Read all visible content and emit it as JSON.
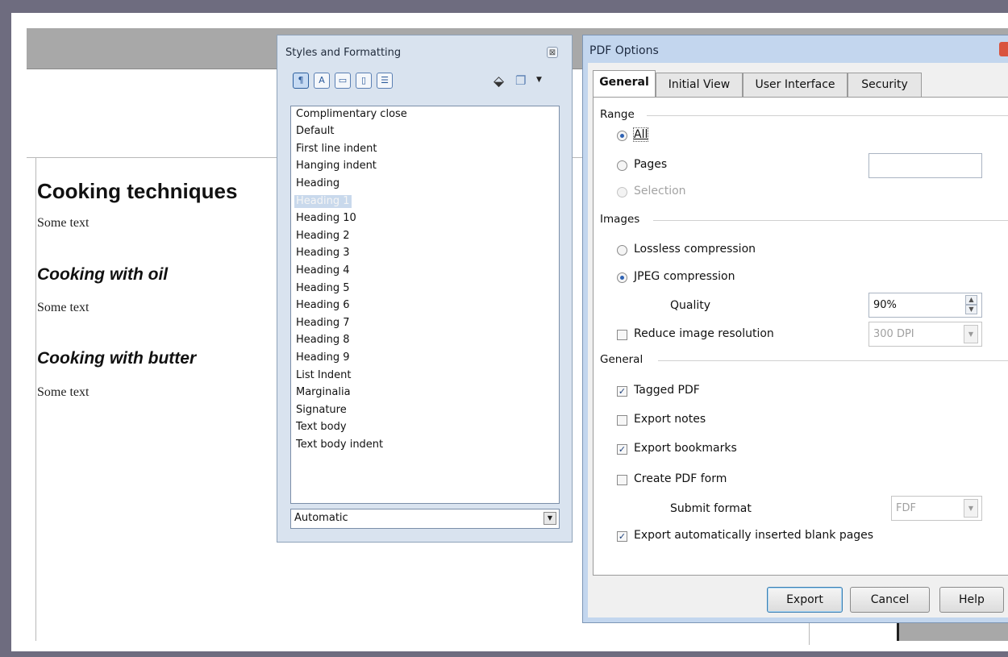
{
  "document": {
    "heading1": "Cooking techniques",
    "p1": "Some text",
    "heading2a": "Cooking with oil",
    "p2": "Some text",
    "heading2b": "Cooking with butter",
    "p3": "Some text"
  },
  "styles_panel": {
    "title": "Styles and Formatting",
    "close_glyph": "⊠",
    "tools": [
      "paragraph-styles",
      "character-styles",
      "frame-styles",
      "page-styles",
      "list-styles"
    ],
    "items": [
      "Complimentary close",
      "Default",
      "First line indent",
      "Hanging indent",
      "Heading",
      "Heading 1",
      "Heading 10",
      "Heading 2",
      "Heading 3",
      "Heading 4",
      "Heading 5",
      "Heading 6",
      "Heading 7",
      "Heading 8",
      "Heading 9",
      "List Indent",
      "Marginalia",
      "Signature",
      "Text body",
      "Text body indent"
    ],
    "selected_item": "Heading 1",
    "filter_value": "Automatic"
  },
  "pdf_dialog": {
    "title": "PDF Options",
    "tabs": [
      "General",
      "Initial View",
      "User Interface",
      "Security"
    ],
    "active_tab": "General",
    "range": {
      "label": "Range",
      "all": "All",
      "pages": "Pages",
      "selection": "Selection",
      "selected": "All",
      "pages_value": ""
    },
    "images": {
      "label": "Images",
      "lossless": "Lossless compression",
      "jpeg": "JPEG compression",
      "selected": "JPEG compression",
      "quality_label": "Quality",
      "quality_value": "90%",
      "reduce_label": "Reduce image resolution",
      "reduce_checked": false,
      "resolution_value": "300 DPI"
    },
    "general": {
      "label": "General",
      "tagged_pdf": "Tagged PDF",
      "tagged_pdf_checked": true,
      "export_notes": "Export notes",
      "export_notes_checked": false,
      "export_bookmarks": "Export bookmarks",
      "export_bookmarks_checked": true,
      "create_form": "Create PDF form",
      "create_form_checked": false,
      "submit_format_label": "Submit format",
      "submit_format_value": "FDF",
      "blank_pages": "Export automatically inserted blank pages",
      "blank_pages_checked": true
    },
    "buttons": {
      "export": "Export",
      "cancel": "Cancel",
      "help": "Help"
    }
  }
}
